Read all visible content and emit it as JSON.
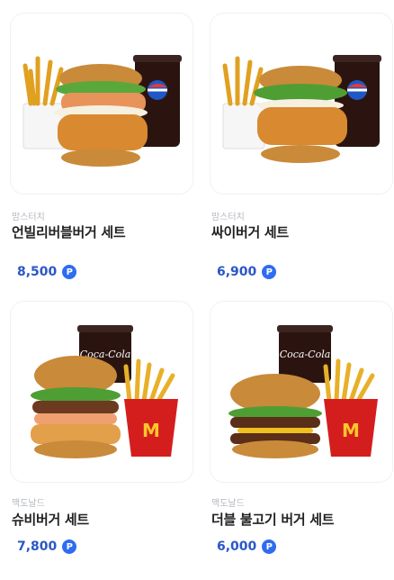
{
  "products": [
    {
      "brand": "맘스터치",
      "name": "언빌리버블버거 세트",
      "price": "8,500",
      "point_badge": "P",
      "image": "mom's touch burger set with fries and pepsi"
    },
    {
      "brand": "맘스터치",
      "name": "싸이버거 세트",
      "price": "6,900",
      "point_badge": "P",
      "image": "mom's touch thigh burger set with fries and pepsi"
    },
    {
      "brand": "맥도날드",
      "name": "슈비버거 세트",
      "price": "7,800",
      "point_badge": "P",
      "image": "mcdonald's burger set with fries and coca-cola"
    },
    {
      "brand": "맥도날드",
      "name": "더블 불고기 버거 세트",
      "price": "6,000",
      "point_badge": "P",
      "image": "mcdonald's double bulgogi burger set with fries and coca-cola"
    }
  ],
  "colors": {
    "price": "#2a57c6",
    "badge": "#2f6cf0",
    "brand": "#b3b8bf"
  }
}
